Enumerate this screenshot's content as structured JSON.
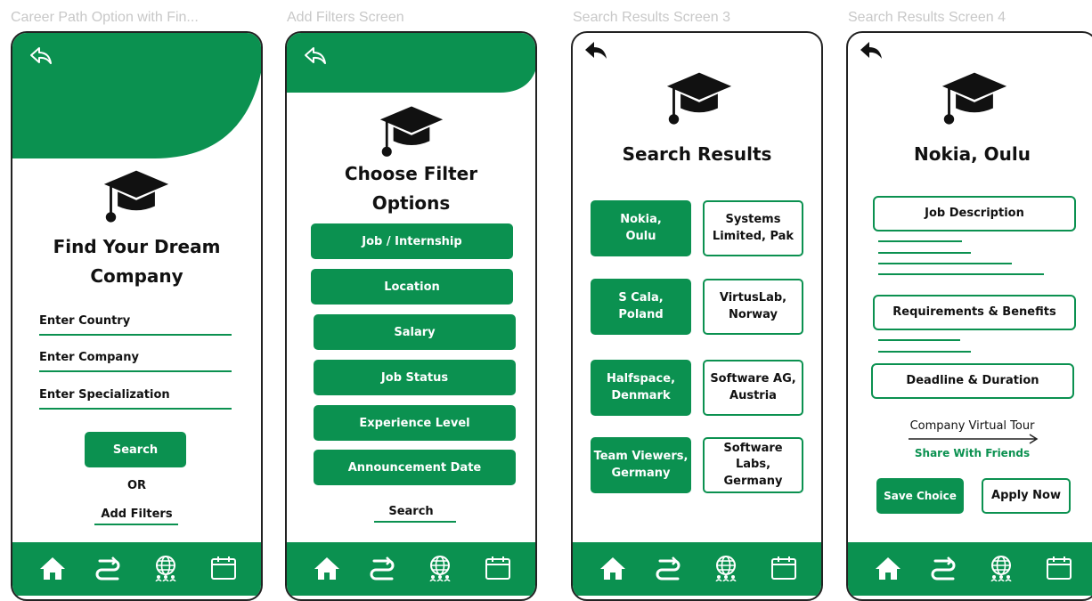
{
  "frames": [
    {
      "title": "Career Path Option with Fin..."
    },
    {
      "title": "Add Filters Screen"
    },
    {
      "title": "Search Results Screen 3"
    },
    {
      "title": "Search Results Screen 4"
    }
  ],
  "colors": {
    "brand_green": "#0b9150",
    "text": "#111111",
    "frame_label": "#c8c8c8"
  },
  "icons": [
    "back-arrow-icon",
    "graduation-cap-icon",
    "home-icon",
    "route-icon",
    "globe-icon",
    "calendar-icon"
  ],
  "screen1": {
    "title_line1": "Find Your Dream",
    "title_line2": "Company",
    "fields": [
      "Enter Country",
      "Enter Company",
      "Enter Specialization"
    ],
    "search_label": "Search",
    "or_label": "OR",
    "add_filters_label": "Add Filters"
  },
  "screen2": {
    "title_line1": "Choose Filter",
    "title_line2": "Options",
    "options": [
      "Job / Internship",
      "Location",
      "Salary",
      "Job Status",
      "Experience Level",
      "Announcement Date"
    ],
    "search_label": "Search"
  },
  "screen3": {
    "title": "Search Results",
    "results": [
      [
        "Nokia,\nOulu",
        "Systems\nLimited, Pak"
      ],
      [
        "S Cala,\nPoland",
        "VirtusLab,\nNorway"
      ],
      [
        "Halfspace,\nDenmark",
        "Software AG,\nAustria"
      ],
      [
        "Team Viewers,\nGermany",
        "Software Labs,\nGermany"
      ]
    ]
  },
  "screen4": {
    "title": "Nokia, Oulu",
    "job_description": "Job Description",
    "requirements": "Requirements & Benefits",
    "deadline": "Deadline & Duration",
    "virtual_tour": "Company Virtual Tour",
    "share": "Share With Friends",
    "save_choice": "Save Choice",
    "apply_now": "Apply Now"
  }
}
